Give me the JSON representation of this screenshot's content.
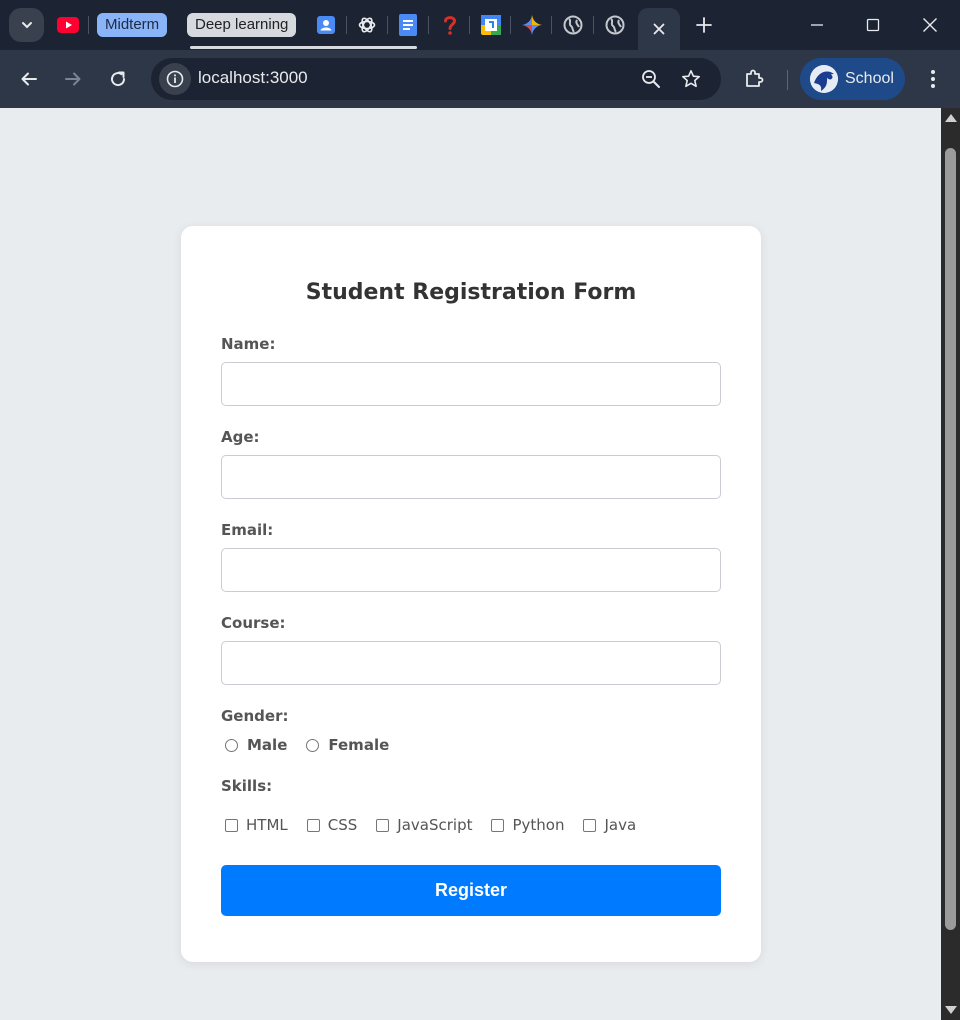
{
  "browser": {
    "tab_groups": [
      {
        "label": "Midterm",
        "color": "#8ab4f8"
      },
      {
        "label": "Deep learning",
        "color": "#d6d9de"
      }
    ],
    "address": "localhost:3000",
    "profile_label": "School"
  },
  "form": {
    "title": "Student Registration Form",
    "fields": {
      "name_label": "Name:",
      "age_label": "Age:",
      "email_label": "Email:",
      "course_label": "Course:",
      "name_value": "",
      "age_value": "",
      "email_value": "",
      "course_value": ""
    },
    "gender": {
      "label": "Gender:",
      "options": [
        "Male",
        "Female"
      ]
    },
    "skills": {
      "label": "Skills:",
      "options": [
        "HTML",
        "CSS",
        "JavaScript",
        "Python",
        "Java"
      ]
    },
    "submit_label": "Register"
  },
  "colors": {
    "accent": "#007bff",
    "page_background": "#e9ecef",
    "browser_frame": "#1c2333"
  }
}
